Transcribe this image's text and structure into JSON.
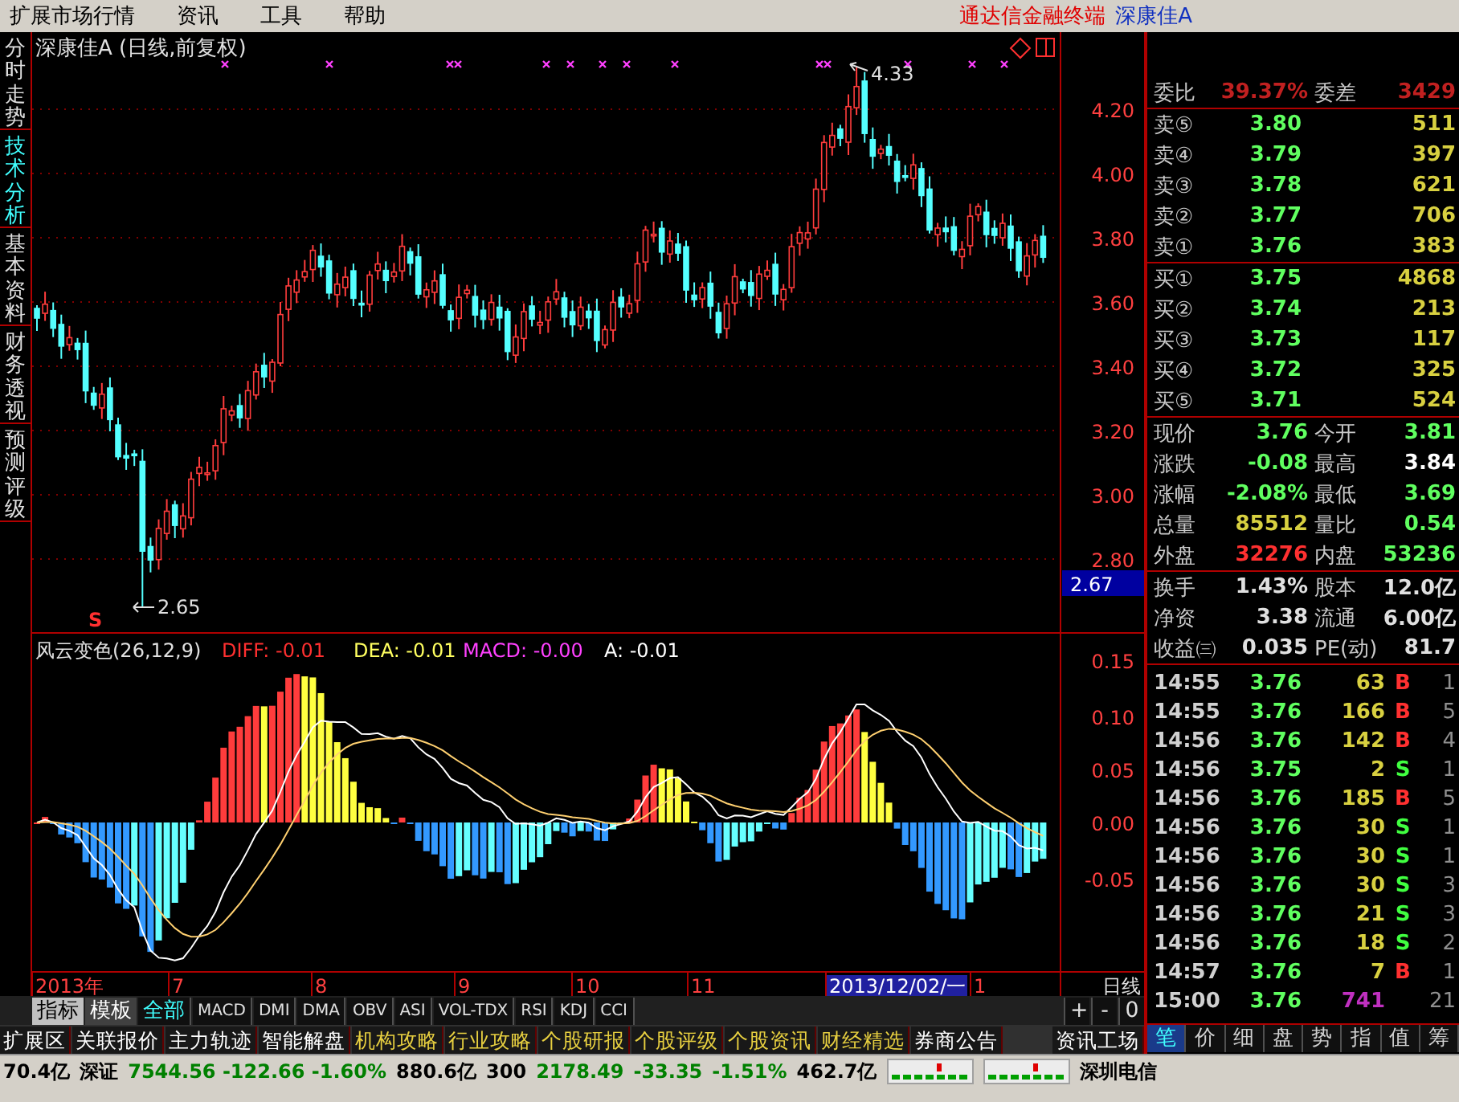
{
  "menu": {
    "items": [
      "扩展市场行情",
      "资讯",
      "工具",
      "帮助"
    ],
    "app_title": "通达信金融终端",
    "stock": "深康佳A"
  },
  "side_tabs": [
    {
      "label": "分时走势",
      "selected": false
    },
    {
      "label": "技术分析",
      "selected": true
    },
    {
      "label": "基本资料",
      "selected": false
    },
    {
      "label": "财务透视",
      "selected": false
    },
    {
      "label": "预测评级",
      "selected": false
    }
  ],
  "price_chart": {
    "title": "深康佳A (日线,前复权)",
    "y_labels": [
      "4.20",
      "4.00",
      "3.80",
      "3.60",
      "3.40",
      "3.20",
      "3.00",
      "2.80"
    ],
    "current_price": "2.67",
    "high_mark": "4.33",
    "low_mark": "2.65",
    "signal": "S"
  },
  "macd": {
    "title": "风云变色(26,12,9)",
    "y_labels": [
      "0.15",
      "0.10",
      "0.05",
      "0.00",
      "-0.05"
    ],
    "legend": [
      {
        "text": "DIFF: -0.01",
        "color": "#ff3030"
      },
      {
        "text": "DEA: -0.01",
        "color": "#ffff60"
      },
      {
        "text": "MACD: -0.00",
        "color": "#ff40ff"
      },
      {
        "text": "A: -0.01",
        "color": "#ffffff"
      }
    ]
  },
  "x_axis": {
    "period": "日线",
    "labels": [
      {
        "text": "2013年",
        "selected": false
      },
      {
        "text": "7",
        "selected": false
      },
      {
        "text": "8",
        "selected": false
      },
      {
        "text": "9",
        "selected": false
      },
      {
        "text": "10",
        "selected": false
      },
      {
        "text": "11",
        "selected": false
      },
      {
        "text": "2013/12/02/一",
        "selected": true
      },
      {
        "text": "1",
        "selected": false
      }
    ]
  },
  "indicator_bar": {
    "buttons": [
      {
        "label": "指标",
        "active": true
      },
      {
        "label": "模板",
        "active": false
      }
    ],
    "tabs": [
      {
        "label": "全部",
        "selected": true
      },
      {
        "label": "MACD",
        "selected": false
      },
      {
        "label": "DMI",
        "selected": false
      },
      {
        "label": "DMA",
        "selected": false
      },
      {
        "label": "OBV",
        "selected": false
      },
      {
        "label": "ASI",
        "selected": false
      },
      {
        "label": "VOL-TDX",
        "selected": false
      },
      {
        "label": "RSI",
        "selected": false
      },
      {
        "label": "KDJ",
        "selected": false
      },
      {
        "label": "CCI",
        "selected": false
      }
    ],
    "controls": [
      "+",
      "-",
      "0"
    ]
  },
  "ext_bar": {
    "items": [
      {
        "label": "扩展区",
        "highlighted": false
      },
      {
        "label": "关联报价",
        "highlighted": false
      },
      {
        "label": "主力轨迹",
        "highlighted": false
      },
      {
        "label": "智能解盘",
        "highlighted": false
      },
      {
        "label": "机构攻略",
        "highlighted": true
      },
      {
        "label": "行业攻略",
        "highlighted": true
      },
      {
        "label": "个股研报",
        "highlighted": true
      },
      {
        "label": "个股评级",
        "highlighted": true
      },
      {
        "label": "个股资讯",
        "highlighted": true
      },
      {
        "label": "财经精选",
        "highlighted": true
      },
      {
        "label": "券商公告",
        "highlighted": false
      }
    ],
    "right": "资讯工场"
  },
  "quote_panel": {
    "ratio": {
      "label": "委比",
      "value": "39.37%",
      "label2": "委差",
      "value2": "3429"
    },
    "asks": [
      {
        "label": "卖⑤",
        "price": "3.80",
        "volume": "511"
      },
      {
        "label": "卖④",
        "price": "3.79",
        "volume": "397"
      },
      {
        "label": "卖③",
        "price": "3.78",
        "volume": "621"
      },
      {
        "label": "卖②",
        "price": "3.77",
        "volume": "706"
      },
      {
        "label": "卖①",
        "price": "3.76",
        "volume": "383"
      }
    ],
    "bids": [
      {
        "label": "买①",
        "price": "3.75",
        "volume": "4868"
      },
      {
        "label": "买②",
        "price": "3.74",
        "volume": "213"
      },
      {
        "label": "买③",
        "price": "3.73",
        "volume": "117"
      },
      {
        "label": "买④",
        "price": "3.72",
        "volume": "325"
      },
      {
        "label": "买⑤",
        "price": "3.71",
        "volume": "524"
      }
    ],
    "stats": [
      {
        "label": "现价",
        "value": "3.76",
        "color": "#60ff60"
      },
      {
        "label": "今开",
        "value": "3.81",
        "color": "#60ff60"
      },
      {
        "label": "涨跌",
        "value": "-0.08",
        "color": "#60ff60"
      },
      {
        "label": "最高",
        "value": "3.84",
        "color": "#ffffff"
      },
      {
        "label": "涨幅",
        "value": "-2.08%",
        "color": "#60ff60"
      },
      {
        "label": "最低",
        "value": "3.69",
        "color": "#60ff60"
      },
      {
        "label": "总量",
        "value": "85512",
        "color": "#d8d040"
      },
      {
        "label": "量比",
        "value": "0.54",
        "color": "#60ff60"
      },
      {
        "label": "外盘",
        "value": "32276",
        "color": "#ff3030"
      },
      {
        "label": "内盘",
        "value": "53236",
        "color": "#60ff60"
      }
    ],
    "finance": [
      {
        "label": "换手",
        "value": "1.43%",
        "label2": "股本",
        "value2": "12.0亿"
      },
      {
        "label": "净资",
        "value": "3.38",
        "label2": "流通",
        "value2": "6.00亿"
      },
      {
        "label": "收益㈢",
        "value": "0.035",
        "label2": "PE(动)",
        "value2": "81.7"
      }
    ],
    "ticks": [
      {
        "time": "14:55",
        "price": "3.76",
        "volume": "63",
        "flag": "B",
        "kind": "buy",
        "count": "1",
        "color": "#d8d040"
      },
      {
        "time": "14:55",
        "price": "3.76",
        "volume": "166",
        "flag": "B",
        "kind": "buy",
        "count": "5",
        "color": "#d8d040"
      },
      {
        "time": "14:56",
        "price": "3.76",
        "volume": "142",
        "flag": "B",
        "kind": "buy",
        "count": "4",
        "color": "#d8d040"
      },
      {
        "time": "14:56",
        "price": "3.75",
        "volume": "2",
        "flag": "S",
        "kind": "sell",
        "count": "1",
        "color": "#d8d040"
      },
      {
        "time": "14:56",
        "price": "3.76",
        "volume": "185",
        "flag": "B",
        "kind": "buy",
        "count": "5",
        "color": "#d8d040"
      },
      {
        "time": "14:56",
        "price": "3.76",
        "volume": "30",
        "flag": "S",
        "kind": "sell",
        "count": "1",
        "color": "#d8d040"
      },
      {
        "time": "14:56",
        "price": "3.76",
        "volume": "30",
        "flag": "S",
        "kind": "sell",
        "count": "1",
        "color": "#d8d040"
      },
      {
        "time": "14:56",
        "price": "3.76",
        "volume": "30",
        "flag": "S",
        "kind": "sell",
        "count": "3",
        "color": "#d8d040"
      },
      {
        "time": "14:56",
        "price": "3.76",
        "volume": "21",
        "flag": "S",
        "kind": "sell",
        "count": "3",
        "color": "#d8d040"
      },
      {
        "time": "14:56",
        "price": "3.76",
        "volume": "18",
        "flag": "S",
        "kind": "sell",
        "count": "2",
        "color": "#d8d040"
      },
      {
        "time": "14:57",
        "price": "3.76",
        "volume": "7",
        "flag": "B",
        "kind": "buy",
        "count": "1",
        "color": "#d8d040"
      },
      {
        "time": "15:00",
        "price": "3.76",
        "volume": "741",
        "kind": "none",
        "count": "21",
        "color": "#c030c0"
      }
    ],
    "tabs": [
      {
        "label": "笔",
        "selected": true
      },
      {
        "label": "价",
        "selected": false
      },
      {
        "label": "细",
        "selected": false
      },
      {
        "label": "盘",
        "selected": false
      },
      {
        "label": "势",
        "selected": false
      },
      {
        "label": "指",
        "selected": false
      },
      {
        "label": "值",
        "selected": false
      },
      {
        "label": "筹",
        "selected": false
      }
    ]
  },
  "status_bar": {
    "items": [
      {
        "text": "70.4亿",
        "color": "#000000"
      },
      {
        "text": "深证",
        "color": "#000000"
      },
      {
        "text": "7544.56 -122.66 -1.60%",
        "color": "#008000"
      },
      {
        "text": "880.6亿",
        "color": "#000000"
      },
      {
        "text": "300",
        "color": "#000000"
      },
      {
        "text": "2178.49",
        "color": "#008000"
      },
      {
        "text": "-33.35",
        "color": "#008000"
      },
      {
        "text": "-1.51%",
        "color": "#008000"
      },
      {
        "text": "462.7亿",
        "color": "#000000"
      }
    ],
    "isp": "深圳电信"
  }
}
